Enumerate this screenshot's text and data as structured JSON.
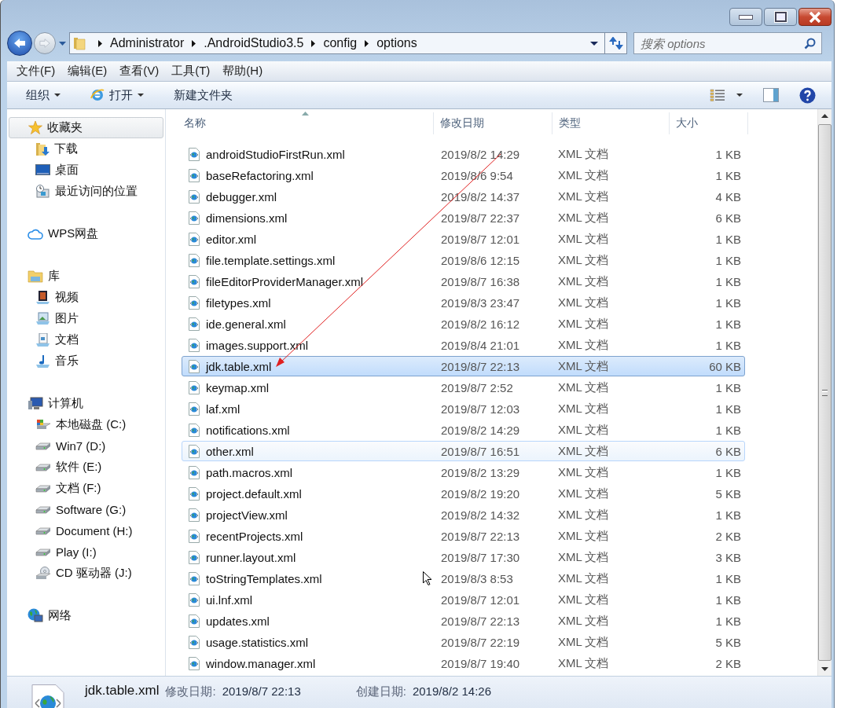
{
  "address_bar": {
    "path": [
      "Administrator",
      ".AndroidStudio3.5",
      "config",
      "options"
    ]
  },
  "search": {
    "placeholder": "搜索 options"
  },
  "menu_bar": [
    "文件(F)",
    "编辑(E)",
    "查看(V)",
    "工具(T)",
    "帮助(H)"
  ],
  "toolbar": [
    {
      "label": "组织",
      "kind": "menu"
    },
    {
      "label": "打开",
      "kind": "open"
    },
    {
      "label": "新建文件夹",
      "kind": "plain"
    }
  ],
  "sidebar": {
    "groups": [
      {
        "label": "收藏夹",
        "selected": true,
        "children": [
          {
            "label": "下载",
            "selected": false
          },
          {
            "label": "桌面",
            "selected": false
          },
          {
            "label": "最近访问的位置",
            "selected": false
          }
        ]
      },
      {
        "label": "WPS网盘",
        "selected": false
      },
      {
        "label": "库",
        "selected": false,
        "children": [
          {
            "label": "视频",
            "selected": false
          },
          {
            "label": "图片",
            "selected": false
          },
          {
            "label": "文档",
            "selected": false
          },
          {
            "label": "音乐",
            "selected": false
          }
        ]
      },
      {
        "label": "计算机",
        "selected": false,
        "children": [
          {
            "label": "本地磁盘 (C:)",
            "selected": false
          },
          {
            "label": "Win7 (D:)",
            "selected": false
          },
          {
            "label": "软件 (E:)",
            "selected": false
          },
          {
            "label": "文档 (F:)",
            "selected": false
          },
          {
            "label": "Software (G:)",
            "selected": false
          },
          {
            "label": "Document (H:)",
            "selected": false
          },
          {
            "label": "Play (I:)",
            "selected": false
          },
          {
            "label": "CD 驱动器 (J:)",
            "selected": false
          }
        ]
      },
      {
        "label": "网络",
        "selected": false
      }
    ]
  },
  "table": {
    "columns": [
      "名称",
      "修改日期",
      "类型",
      "大小"
    ],
    "rows": [
      {
        "name": "androidStudioFirstRun.xml",
        "modified": "2019/8/2 14:29",
        "type": "XML 文档",
        "size": "1 KB",
        "selected": false,
        "hovered": false
      },
      {
        "name": "baseRefactoring.xml",
        "modified": "2019/8/6 9:54",
        "type": "XML 文档",
        "size": "1 KB",
        "selected": false,
        "hovered": false
      },
      {
        "name": "debugger.xml",
        "modified": "2019/8/2 14:37",
        "type": "XML 文档",
        "size": "4 KB",
        "selected": false,
        "hovered": false
      },
      {
        "name": "dimensions.xml",
        "modified": "2019/8/7 22:37",
        "type": "XML 文档",
        "size": "6 KB",
        "selected": false,
        "hovered": false
      },
      {
        "name": "editor.xml",
        "modified": "2019/8/7 12:01",
        "type": "XML 文档",
        "size": "1 KB",
        "selected": false,
        "hovered": false
      },
      {
        "name": "file.template.settings.xml",
        "modified": "2019/8/6 12:15",
        "type": "XML 文档",
        "size": "1 KB",
        "selected": false,
        "hovered": false
      },
      {
        "name": "fileEditorProviderManager.xml",
        "modified": "2019/8/7 16:38",
        "type": "XML 文档",
        "size": "1 KB",
        "selected": false,
        "hovered": false
      },
      {
        "name": "filetypes.xml",
        "modified": "2019/8/3 23:47",
        "type": "XML 文档",
        "size": "1 KB",
        "selected": false,
        "hovered": false
      },
      {
        "name": "ide.general.xml",
        "modified": "2019/8/2 16:12",
        "type": "XML 文档",
        "size": "1 KB",
        "selected": false,
        "hovered": false
      },
      {
        "name": "images.support.xml",
        "modified": "2019/8/4 21:01",
        "type": "XML 文档",
        "size": "1 KB",
        "selected": false,
        "hovered": false
      },
      {
        "name": "jdk.table.xml",
        "modified": "2019/8/7 22:13",
        "type": "XML 文档",
        "size": "60 KB",
        "selected": true,
        "hovered": false
      },
      {
        "name": "keymap.xml",
        "modified": "2019/8/7 2:52",
        "type": "XML 文档",
        "size": "1 KB",
        "selected": false,
        "hovered": false
      },
      {
        "name": "laf.xml",
        "modified": "2019/8/7 12:03",
        "type": "XML 文档",
        "size": "1 KB",
        "selected": false,
        "hovered": false
      },
      {
        "name": "notifications.xml",
        "modified": "2019/8/2 14:29",
        "type": "XML 文档",
        "size": "1 KB",
        "selected": false,
        "hovered": false
      },
      {
        "name": "other.xml",
        "modified": "2019/8/7 16:51",
        "type": "XML 文档",
        "size": "6 KB",
        "selected": false,
        "hovered": true
      },
      {
        "name": "path.macros.xml",
        "modified": "2019/8/2 13:29",
        "type": "XML 文档",
        "size": "1 KB",
        "selected": false,
        "hovered": false
      },
      {
        "name": "project.default.xml",
        "modified": "2019/8/2 19:20",
        "type": "XML 文档",
        "size": "5 KB",
        "selected": false,
        "hovered": false
      },
      {
        "name": "projectView.xml",
        "modified": "2019/8/2 14:32",
        "type": "XML 文档",
        "size": "1 KB",
        "selected": false,
        "hovered": false
      },
      {
        "name": "recentProjects.xml",
        "modified": "2019/8/7 22:13",
        "type": "XML 文档",
        "size": "2 KB",
        "selected": false,
        "hovered": false
      },
      {
        "name": "runner.layout.xml",
        "modified": "2019/8/7 17:30",
        "type": "XML 文档",
        "size": "3 KB",
        "selected": false,
        "hovered": false
      },
      {
        "name": "toStringTemplates.xml",
        "modified": "2019/8/3 8:53",
        "type": "XML 文档",
        "size": "1 KB",
        "selected": false,
        "hovered": false
      },
      {
        "name": "ui.lnf.xml",
        "modified": "2019/8/7 12:01",
        "type": "XML 文档",
        "size": "1 KB",
        "selected": false,
        "hovered": false
      },
      {
        "name": "updates.xml",
        "modified": "2019/8/7 22:13",
        "type": "XML 文档",
        "size": "1 KB",
        "selected": false,
        "hovered": false
      },
      {
        "name": "usage.statistics.xml",
        "modified": "2019/8/7 22:19",
        "type": "XML 文档",
        "size": "5 KB",
        "selected": false,
        "hovered": false
      },
      {
        "name": "window.manager.xml",
        "modified": "2019/8/7 19:40",
        "type": "XML 文档",
        "size": "2 KB",
        "selected": false,
        "hovered": false
      }
    ]
  },
  "details_pane": {
    "name": "jdk.table.xml",
    "fields": [
      {
        "label": "修改日期:",
        "value": "2019/8/7 22:13"
      },
      {
        "label": "创建日期:",
        "value": "2019/8/2 14:26"
      }
    ]
  }
}
